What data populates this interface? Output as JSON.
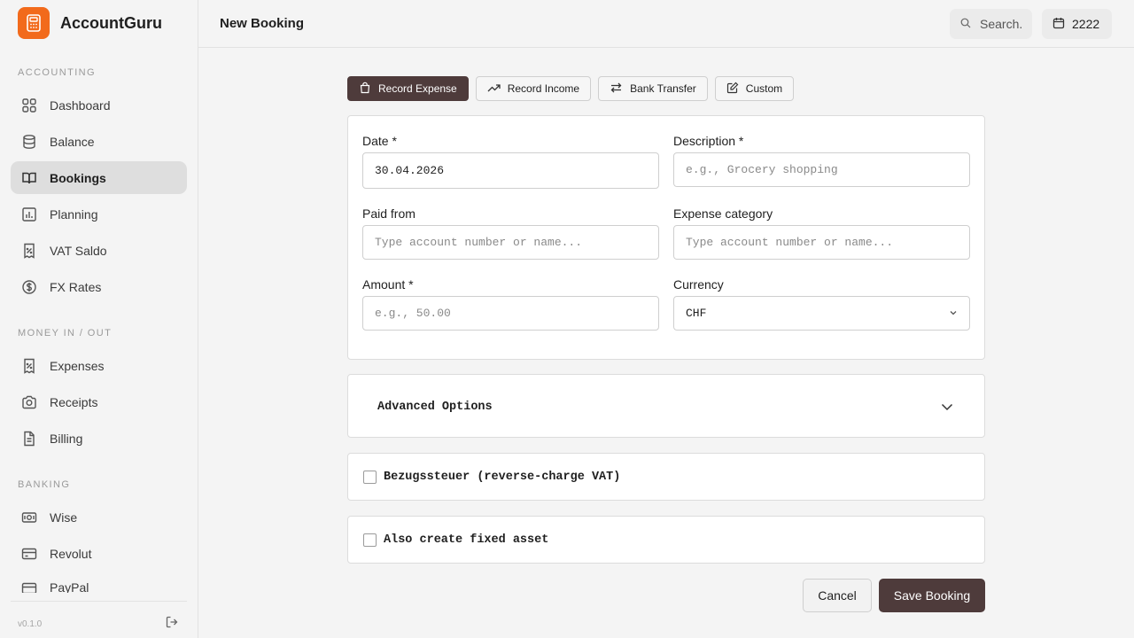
{
  "app": {
    "name": "AccountGuru",
    "version": "v0.1.0"
  },
  "sidebar": {
    "sections": [
      {
        "title": "ACCOUNTING"
      },
      {
        "title": "MONEY IN / OUT"
      },
      {
        "title": "BANKING"
      }
    ],
    "items": [
      {
        "label": "Dashboard",
        "icon": "grid-icon"
      },
      {
        "label": "Balance",
        "icon": "database-icon"
      },
      {
        "label": "Bookings",
        "icon": "book-icon",
        "active": true
      },
      {
        "label": "Planning",
        "icon": "bar-chart-icon"
      },
      {
        "label": "VAT Saldo",
        "icon": "receipt-percent-icon"
      },
      {
        "label": "FX Rates",
        "icon": "dollar-circle-icon"
      },
      {
        "label": "Expenses",
        "icon": "receipt-percent-icon"
      },
      {
        "label": "Receipts",
        "icon": "camera-icon"
      },
      {
        "label": "Billing",
        "icon": "document-icon"
      },
      {
        "label": "Wise",
        "icon": "banknote-icon"
      },
      {
        "label": "Revolut",
        "icon": "credit-card-icon"
      },
      {
        "label": "PayPal",
        "icon": "credit-card-icon"
      }
    ]
  },
  "header": {
    "title": "New Booking",
    "search_placeholder": "Search.",
    "year": "2222"
  },
  "tabs": [
    {
      "label": "Record Expense",
      "icon": "shopping-bag-icon",
      "active": true
    },
    {
      "label": "Record Income",
      "icon": "trending-up-icon"
    },
    {
      "label": "Bank Transfer",
      "icon": "arrows-exchange-icon"
    },
    {
      "label": "Custom",
      "icon": "edit-icon"
    }
  ],
  "form": {
    "date": {
      "label": "Date *",
      "value": "30.04.2026"
    },
    "description": {
      "label": "Description *",
      "placeholder": "e.g., Grocery shopping"
    },
    "paid_from": {
      "label": "Paid from",
      "placeholder": "Type account number or name..."
    },
    "expense_category": {
      "label": "Expense category",
      "placeholder": "Type account number or name..."
    },
    "amount": {
      "label": "Amount *",
      "placeholder": "e.g., 50.00"
    },
    "currency": {
      "label": "Currency",
      "value": "CHF"
    }
  },
  "advanced": {
    "title": "Advanced Options"
  },
  "options": {
    "reverse_charge": "Bezugssteuer (reverse-charge VAT)",
    "fixed_asset": "Also create fixed asset"
  },
  "actions": {
    "cancel": "Cancel",
    "save": "Save Booking"
  },
  "colors": {
    "accent": "#4e3b3b",
    "brand": "#f26a1b"
  }
}
